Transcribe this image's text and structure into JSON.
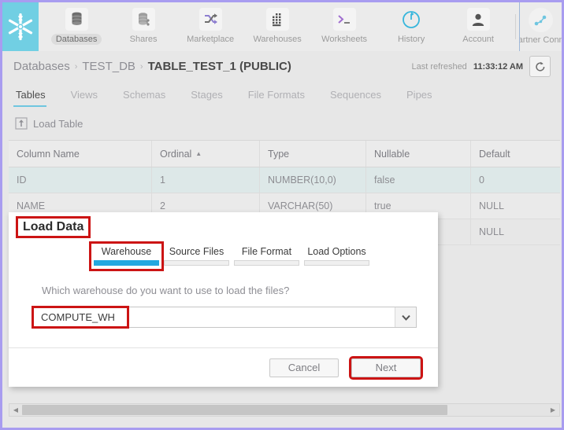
{
  "topnav": {
    "logo_icon": "snowflake-logo-icon",
    "items": [
      {
        "label": "Databases",
        "icon": "database-stack-icon",
        "active": true
      },
      {
        "label": "Shares",
        "icon": "database-share-icon",
        "active": false
      },
      {
        "label": "Marketplace",
        "icon": "shuffle-arrows-icon",
        "active": false
      },
      {
        "label": "Warehouses",
        "icon": "grid-squares-icon",
        "active": false
      },
      {
        "label": "Worksheets",
        "icon": "terminal-prompt-icon",
        "active": false
      },
      {
        "label": "History",
        "icon": "circular-arrow-icon",
        "active": false
      },
      {
        "label": "Account",
        "icon": "person-icon",
        "active": false
      }
    ],
    "partner_connect_label": "Partner Connect",
    "partner_connect_icon": "connect-nodes-icon"
  },
  "breadcrumb": {
    "items": [
      "Databases",
      "TEST_DB",
      "TABLE_TEST_1 (PUBLIC)"
    ],
    "separator": "›"
  },
  "refresh": {
    "label": "Last refreshed",
    "time": "11:33:12 AM",
    "icon": "refresh-icon"
  },
  "page_tabs": [
    {
      "label": "Tables",
      "active": true
    },
    {
      "label": "Views",
      "active": false
    },
    {
      "label": "Schemas",
      "active": false
    },
    {
      "label": "Stages",
      "active": false
    },
    {
      "label": "File Formats",
      "active": false
    },
    {
      "label": "Sequences",
      "active": false
    },
    {
      "label": "Pipes",
      "active": false
    }
  ],
  "toolbar": {
    "load_table_label": "Load Table",
    "load_table_icon": "upload-box-icon"
  },
  "grid": {
    "columns": [
      "Column Name",
      "Ordinal",
      "Type",
      "Nullable",
      "Default"
    ],
    "sorted_column": "Ordinal",
    "sort_caret": "▲",
    "rows": [
      [
        "ID",
        "1",
        "NUMBER(10,0)",
        "false",
        "0"
      ],
      [
        "NAME",
        "2",
        "VARCHAR(50)",
        "true",
        "NULL"
      ],
      [
        "",
        "",
        "",
        "",
        "NULL"
      ]
    ]
  },
  "modal": {
    "title": "Load Data",
    "tabs": [
      {
        "label": "Warehouse",
        "active": true
      },
      {
        "label": "Source Files",
        "active": false
      },
      {
        "label": "File Format",
        "active": false
      },
      {
        "label": "Load Options",
        "active": false
      }
    ],
    "question": "Which warehouse do you want to use to load the files?",
    "warehouse_value": "COMPUTE_WH",
    "dropdown_icon": "chevron-down-icon",
    "cancel_label": "Cancel",
    "next_label": "Next"
  },
  "scrollbar": {
    "left_arrow_icon": "caret-left-icon",
    "right_arrow_icon": "caret-right-icon"
  },
  "colors": {
    "logo_bg": "#71cfe3",
    "accent_blue": "#23a8e0",
    "tab_underline": "#6fc6e0",
    "highlight_red": "#cc1414",
    "page_border_violet": "#a89cf0",
    "selected_row": "#dde8e8"
  }
}
